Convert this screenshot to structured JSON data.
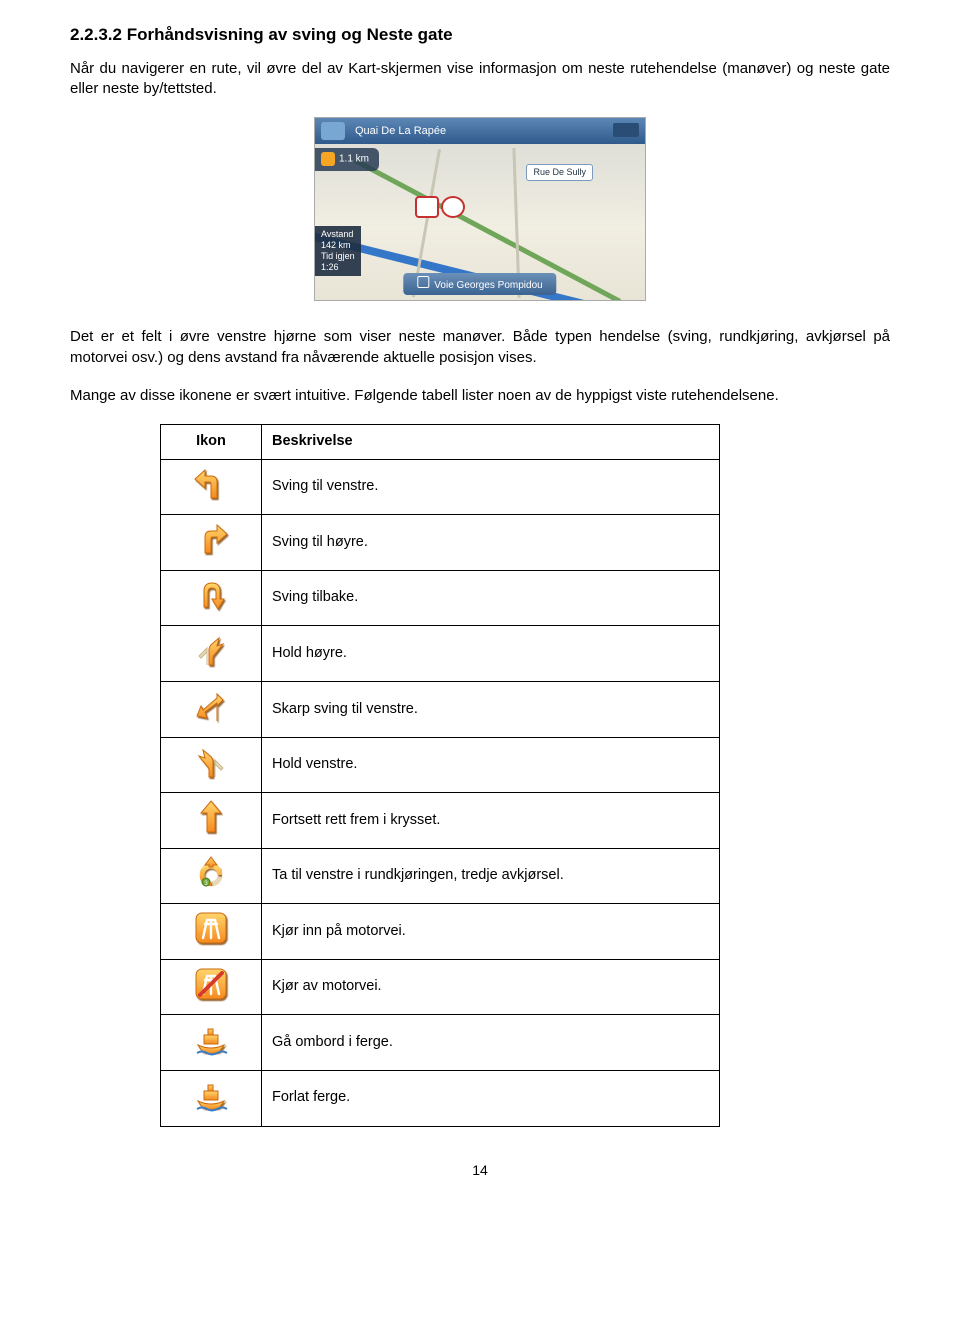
{
  "heading": "2.2.3.2 Forhåndsvisning av sving og Neste gate",
  "para1": "Når du navigerer en rute, vil øvre del av Kart-skjermen vise informasjon om neste rutehendelse (manøver) og neste gate eller neste by/tettsted.",
  "nav": {
    "topstreet": "Quai De La Rapée",
    "street2": "Rue De Sully",
    "distance": "1.1 km",
    "avstand": "142 km",
    "tid": "1:26",
    "bottom": "Voie Georges Pompidou"
  },
  "para2": "Det er et felt i øvre venstre hjørne som viser neste manøver. Både typen hendelse (sving, rundkjøring, avkjørsel på motorvei osv.) og dens avstand fra nåværende aktuelle posisjon vises.",
  "para3": "Mange av disse ikonene er svært intuitive. Følgende tabell lister noen av de hyppigst viste rutehendelsene.",
  "table": {
    "hdr_icon": "Ikon",
    "hdr_desc": "Beskrivelse",
    "rows": [
      {
        "icon": "turn-left",
        "desc": "Sving til venstre."
      },
      {
        "icon": "turn-right",
        "desc": "Sving til høyre."
      },
      {
        "icon": "u-turn",
        "desc": "Sving tilbake."
      },
      {
        "icon": "bear-right",
        "desc": "Hold høyre."
      },
      {
        "icon": "sharp-left",
        "desc": "Skarp sving til venstre."
      },
      {
        "icon": "bear-left",
        "desc": "Hold venstre."
      },
      {
        "icon": "straight",
        "desc": "Fortsett rett frem i krysset."
      },
      {
        "icon": "roundabout",
        "desc": "Ta til venstre i rundkjøringen, tredje avkjørsel."
      },
      {
        "icon": "motorway-on",
        "desc": "Kjør inn på motorvei."
      },
      {
        "icon": "motorway-off",
        "desc": "Kjør av motorvei."
      },
      {
        "icon": "ferry-on",
        "desc": "Gå ombord i ferge."
      },
      {
        "icon": "ferry-off",
        "desc": "Forlat ferge."
      }
    ]
  },
  "page_number": "14"
}
